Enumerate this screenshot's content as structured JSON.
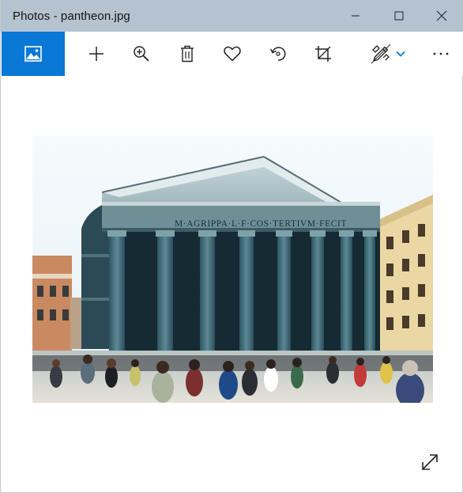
{
  "window": {
    "title": "Photos - pantheon.jpg",
    "controls": {
      "minimize_icon": "minimize-icon",
      "maximize_icon": "maximize-icon",
      "close_icon": "close-icon"
    }
  },
  "toolbar": {
    "items": [
      {
        "name": "see-all-photos",
        "icon": "photos-icon"
      },
      {
        "name": "add-to",
        "icon": "plus-icon"
      },
      {
        "name": "zoom",
        "icon": "zoom-in-icon"
      },
      {
        "name": "delete",
        "icon": "trash-icon"
      },
      {
        "name": "favorite",
        "icon": "heart-icon"
      },
      {
        "name": "rotate",
        "icon": "rotate-icon"
      },
      {
        "name": "crop",
        "icon": "crop-icon"
      },
      {
        "name": "edit-and-create",
        "icon": "draw-icon"
      },
      {
        "name": "edit-dropdown",
        "icon": "chevron-down-icon"
      },
      {
        "name": "see-more",
        "icon": "ellipsis-icon"
      }
    ]
  },
  "photo": {
    "inscription": "M·AGRIPPA·L·F·COS·TERTIVM·FECIT"
  },
  "colors": {
    "titlebar": "#b5c3d1",
    "accent": "#0a78d7",
    "sky": "#eef6fa",
    "stone": "#3f6a76",
    "building": "#e8d5a0"
  }
}
